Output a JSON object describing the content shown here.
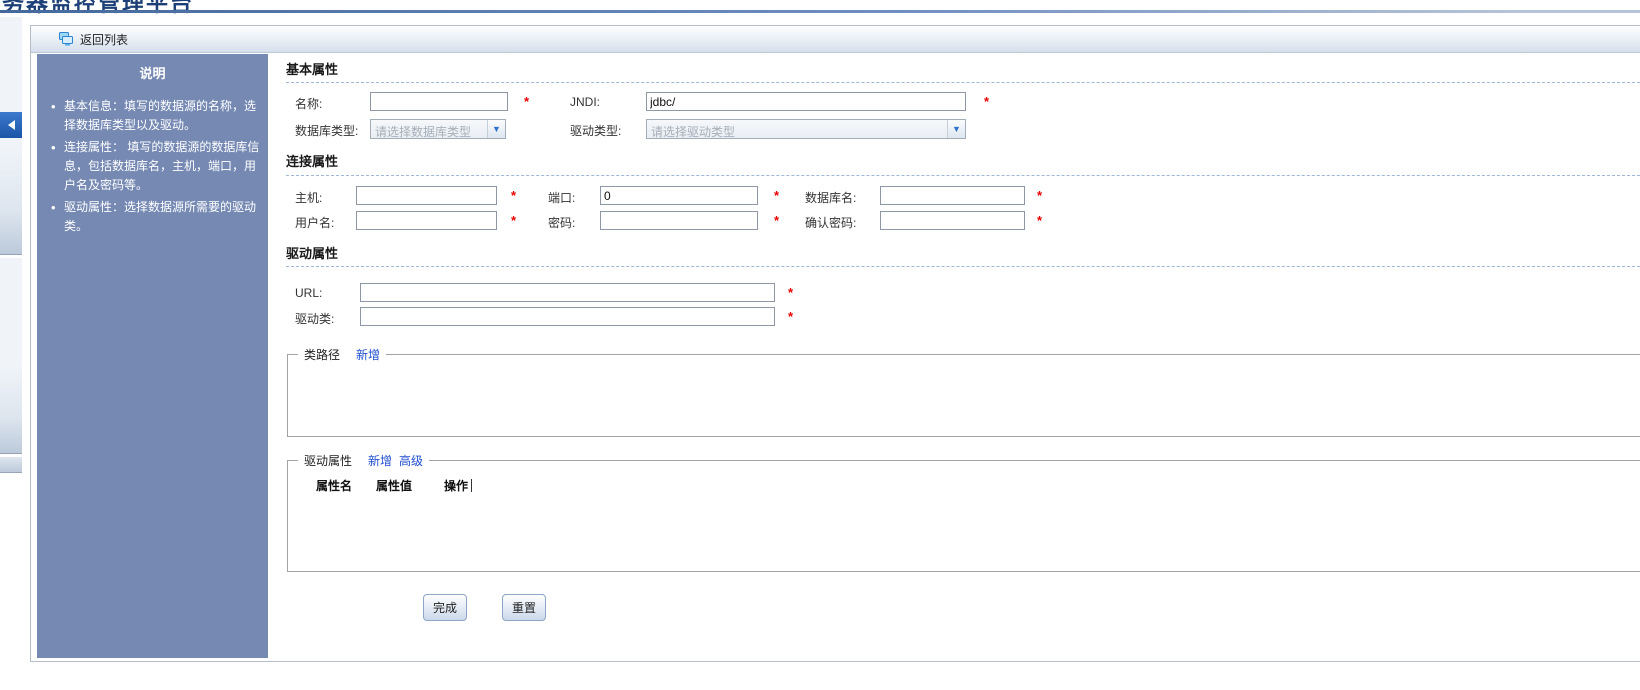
{
  "page": {
    "title_clipped": "务器监控管理平台"
  },
  "toolbar": {
    "back_label": "返回列表"
  },
  "sidebar": {
    "title": "说明",
    "items": [
      "基本信息：填写的数据源的名称，选择数据库类型以及驱动。",
      "连接属性： 填写的数据源的数据库信息，包括数据库名，主机，端口，用户名及密码等。",
      "驱动属性：选择数据源所需要的驱动类。"
    ]
  },
  "form": {
    "required_marker": "*",
    "section_basic": "基本属性",
    "section_connection": "连接属性",
    "section_driver": "驱动属性",
    "fields": {
      "name": {
        "label": "名称:",
        "value": ""
      },
      "jndi": {
        "label": "JNDI:",
        "value": "jdbc/"
      },
      "db_type": {
        "label": "数据库类型:",
        "selected": "请选择数据库类型"
      },
      "driver_type": {
        "label": "驱动类型:",
        "selected": "请选择驱动类型"
      },
      "host": {
        "label": "主机:",
        "value": ""
      },
      "port": {
        "label": "端口:",
        "value": "0"
      },
      "db_name": {
        "label": "数据库名:",
        "value": ""
      },
      "username": {
        "label": "用户名:",
        "value": ""
      },
      "password": {
        "label": "密码:",
        "value": ""
      },
      "confirm_password": {
        "label": "确认密码:",
        "value": ""
      },
      "url": {
        "label": "URL:",
        "value": ""
      },
      "driver_class": {
        "label": "驱动类:",
        "value": ""
      }
    },
    "classpath_group": {
      "legend": "类路径",
      "add_link": "新增"
    },
    "driver_props_group": {
      "legend": "驱动属性",
      "add_link": "新增",
      "advanced_link": "高级",
      "table_headers": [
        "属性名",
        "属性值",
        "操作"
      ]
    },
    "buttons": {
      "finish": "完成",
      "reset": "重置"
    }
  },
  "icons": {
    "back_button": "stacked-windows-icon",
    "select_chevron": "chevron-down-icon",
    "collapse": "arrow-left-icon"
  },
  "colors": {
    "sidebar_bg": "#7589b3",
    "title_text": "#1c3f77",
    "title_rule": "#44699c",
    "link": "#1f4ecf",
    "required": "#e60000",
    "collapse_button": "#1b58b0"
  }
}
